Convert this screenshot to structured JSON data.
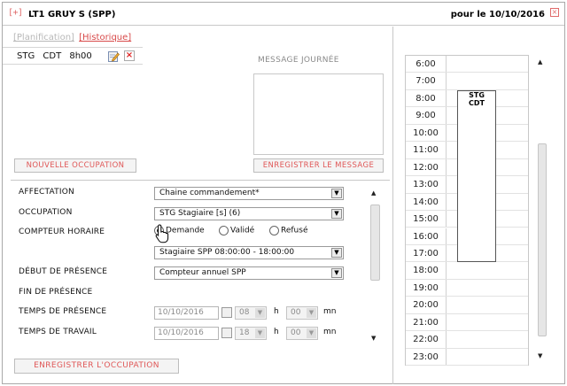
{
  "window": {
    "expand_label": "[+]",
    "title": "LT1 GRUY S (SPP)",
    "date_label": "pour le 10/10/2016",
    "close_label": "×"
  },
  "links": {
    "planification": "[Planification]",
    "historique": "[Historique]"
  },
  "occupation_entry": "STG CDT 8h00",
  "message": {
    "label": "MESSAGE JOURNÉE",
    "value": ""
  },
  "buttons": {
    "new_occupation": "NOUVELLE OCCUPATION",
    "save_message": "ENREGISTRER LE MESSAGE",
    "save_occupation": "ENREGISTRER L'OCCUPATION"
  },
  "form": {
    "affectation": {
      "label": "AFFECTATION",
      "value": "Chaine commandement*"
    },
    "occupation": {
      "label": "OCCUPATION",
      "value": "STG Stagiaire [s] (6)"
    },
    "compteur_horaire": {
      "label": "COMPTEUR HORAIRE",
      "options": [
        "Demande",
        "Validé",
        "Refusé"
      ],
      "selected": "Demande",
      "schedule_value": "Stagiaire SPP 08:00:00 - 18:00:00"
    },
    "debut_presence": {
      "label": "DÉBUT DE PRÉSENCE",
      "value": "Compteur annuel SPP"
    },
    "fin_presence": {
      "label": "FIN DE PRÉSENCE"
    },
    "temps_presence": {
      "label": "TEMPS DE PRÉSENCE",
      "date": "10/10/2016",
      "hours": "08",
      "minutes": "00"
    },
    "temps_travail": {
      "label": "TEMPS DE TRAVAIL",
      "date": "10/10/2016",
      "hours": "18",
      "minutes": "00"
    },
    "unit_h": "h",
    "unit_mn": "mn"
  },
  "agenda": {
    "hours": [
      "6:00",
      "7:00",
      "8:00",
      "9:00",
      "10:00",
      "11:00",
      "12:00",
      "13:00",
      "14:00",
      "15:00",
      "16:00",
      "17:00",
      "18:00",
      "19:00",
      "20:00",
      "21:00",
      "22:00",
      "23:00"
    ],
    "appointment": {
      "line1": "STG",
      "line2": "CDT",
      "start": "8:00",
      "end": "18:00"
    }
  },
  "colors": {
    "accent_red": "#e05757",
    "border": "#c8c8c8"
  }
}
